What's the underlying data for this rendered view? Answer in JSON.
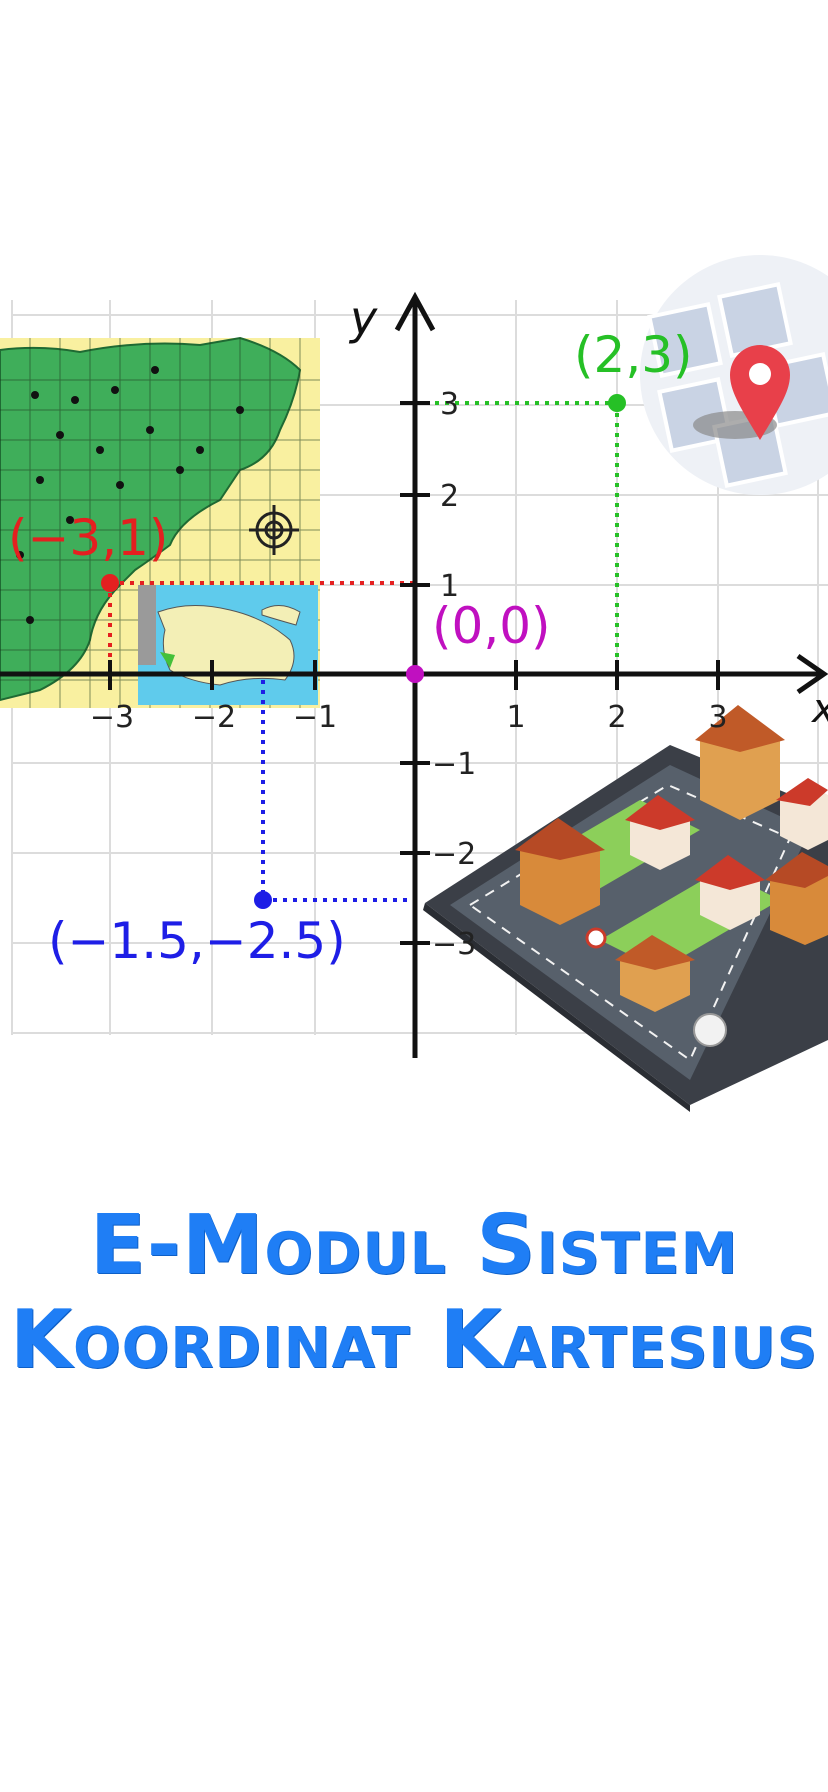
{
  "axes": {
    "x_label": "x",
    "y_label": "y",
    "x_ticks": [
      "−3",
      "−2",
      "−1",
      "1",
      "2",
      "3"
    ],
    "y_ticks": [
      "3",
      "2",
      "1",
      "−1",
      "−2",
      "−3"
    ]
  },
  "points": [
    {
      "label": "(2,3)",
      "color": "#26c026"
    },
    {
      "label": "(−3,1)",
      "color": "#e42020"
    },
    {
      "label": "(0,0)",
      "color": "#c010c0"
    },
    {
      "label": "(−1.5,−2.5)",
      "color": "#1e1ee6"
    }
  ],
  "title": {
    "line1": "E-Modul Sistem",
    "line2": "Koordinat Kartesius"
  },
  "colors": {
    "title": "#1f7ef5",
    "map_land": "#3fae5a",
    "map_bg": "#f9f0a0",
    "marker": "#e8404a"
  },
  "icons": [
    "map-image",
    "location-pin-icon",
    "compass-icon",
    "city-block-image"
  ]
}
